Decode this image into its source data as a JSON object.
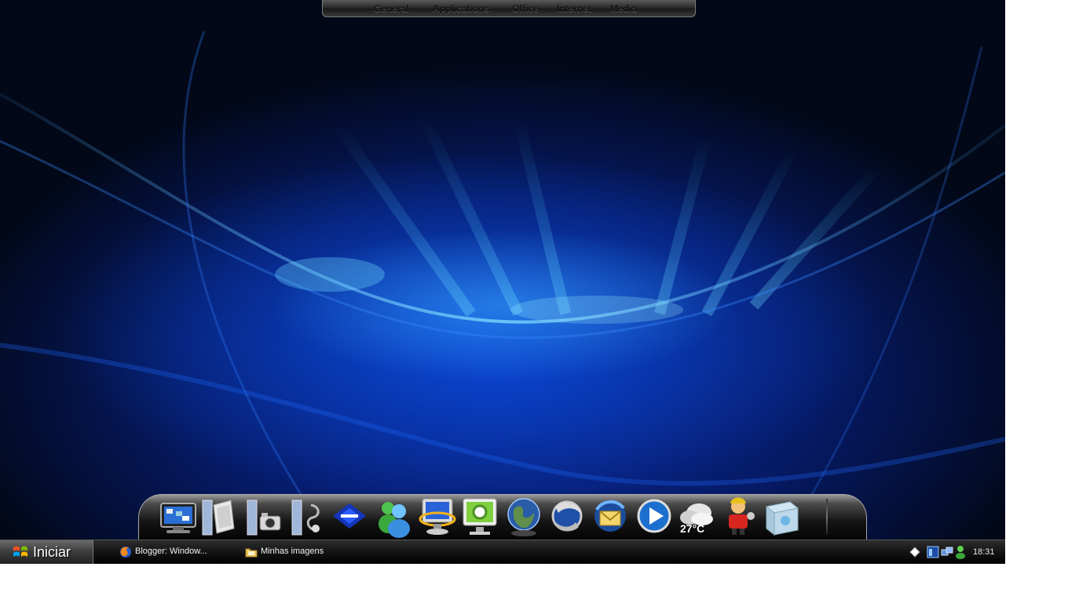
{
  "top_menu": {
    "items": [
      "General",
      "Applications",
      "Office",
      "Internet",
      "Media"
    ]
  },
  "dock": {
    "icons": [
      "desktop-monitor-icon",
      "documents-icon",
      "pictures-camera-icon",
      "music-folder-icon",
      "receita-federal-icon",
      "messenger-icon",
      "my-computer-icon",
      "control-panel-icon",
      "globe-icon",
      "web-browser-icon",
      "thunderbird-icon",
      "media-player-icon",
      "weather-icon",
      "character-icon",
      "recycle-bin-icon"
    ],
    "weather_temp": "27°C"
  },
  "taskbar": {
    "start_label": "Iniciar",
    "tasks": [
      {
        "label": "Blogger: Window...",
        "icon": "firefox-icon"
      },
      {
        "label": "Minhas imagens",
        "icon": "folder-icon"
      }
    ],
    "clock": "18:31"
  },
  "colors": {
    "wallpaper_glow": "#2a9cff",
    "wallpaper_deep": "#061a66",
    "taskbar": "#141414"
  }
}
